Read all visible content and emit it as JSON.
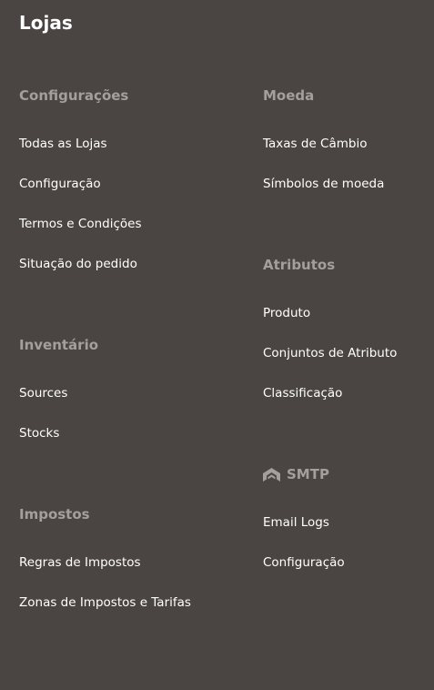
{
  "page": {
    "title": "Lojas"
  },
  "left_column": {
    "configuracoes": {
      "heading": "Configurações",
      "items": [
        "Todas as Lojas",
        "Configuração",
        "Termos e Condições",
        "Situação do pedido"
      ]
    },
    "inventario": {
      "heading": "Inventário",
      "items": [
        "Sources",
        "Stocks"
      ]
    },
    "impostos": {
      "heading": "Impostos",
      "items": [
        "Regras de Impostos",
        "Zonas de Impostos e Tarifas"
      ]
    }
  },
  "right_column": {
    "moeda": {
      "heading": "Moeda",
      "items": [
        "Taxas de Câmbio",
        "Símbolos de moeda"
      ]
    },
    "atributos": {
      "heading": "Atributos",
      "items": [
        "Produto",
        "Conjuntos de Atributo",
        "Classificação"
      ]
    },
    "smtp": {
      "heading": "SMTP",
      "icon": "smtp-logo-icon",
      "items": [
        "Email Logs",
        "Configuração"
      ]
    }
  },
  "colors": {
    "background": "#4a4542",
    "heading": "#a39f9b",
    "link": "#ffffff"
  }
}
